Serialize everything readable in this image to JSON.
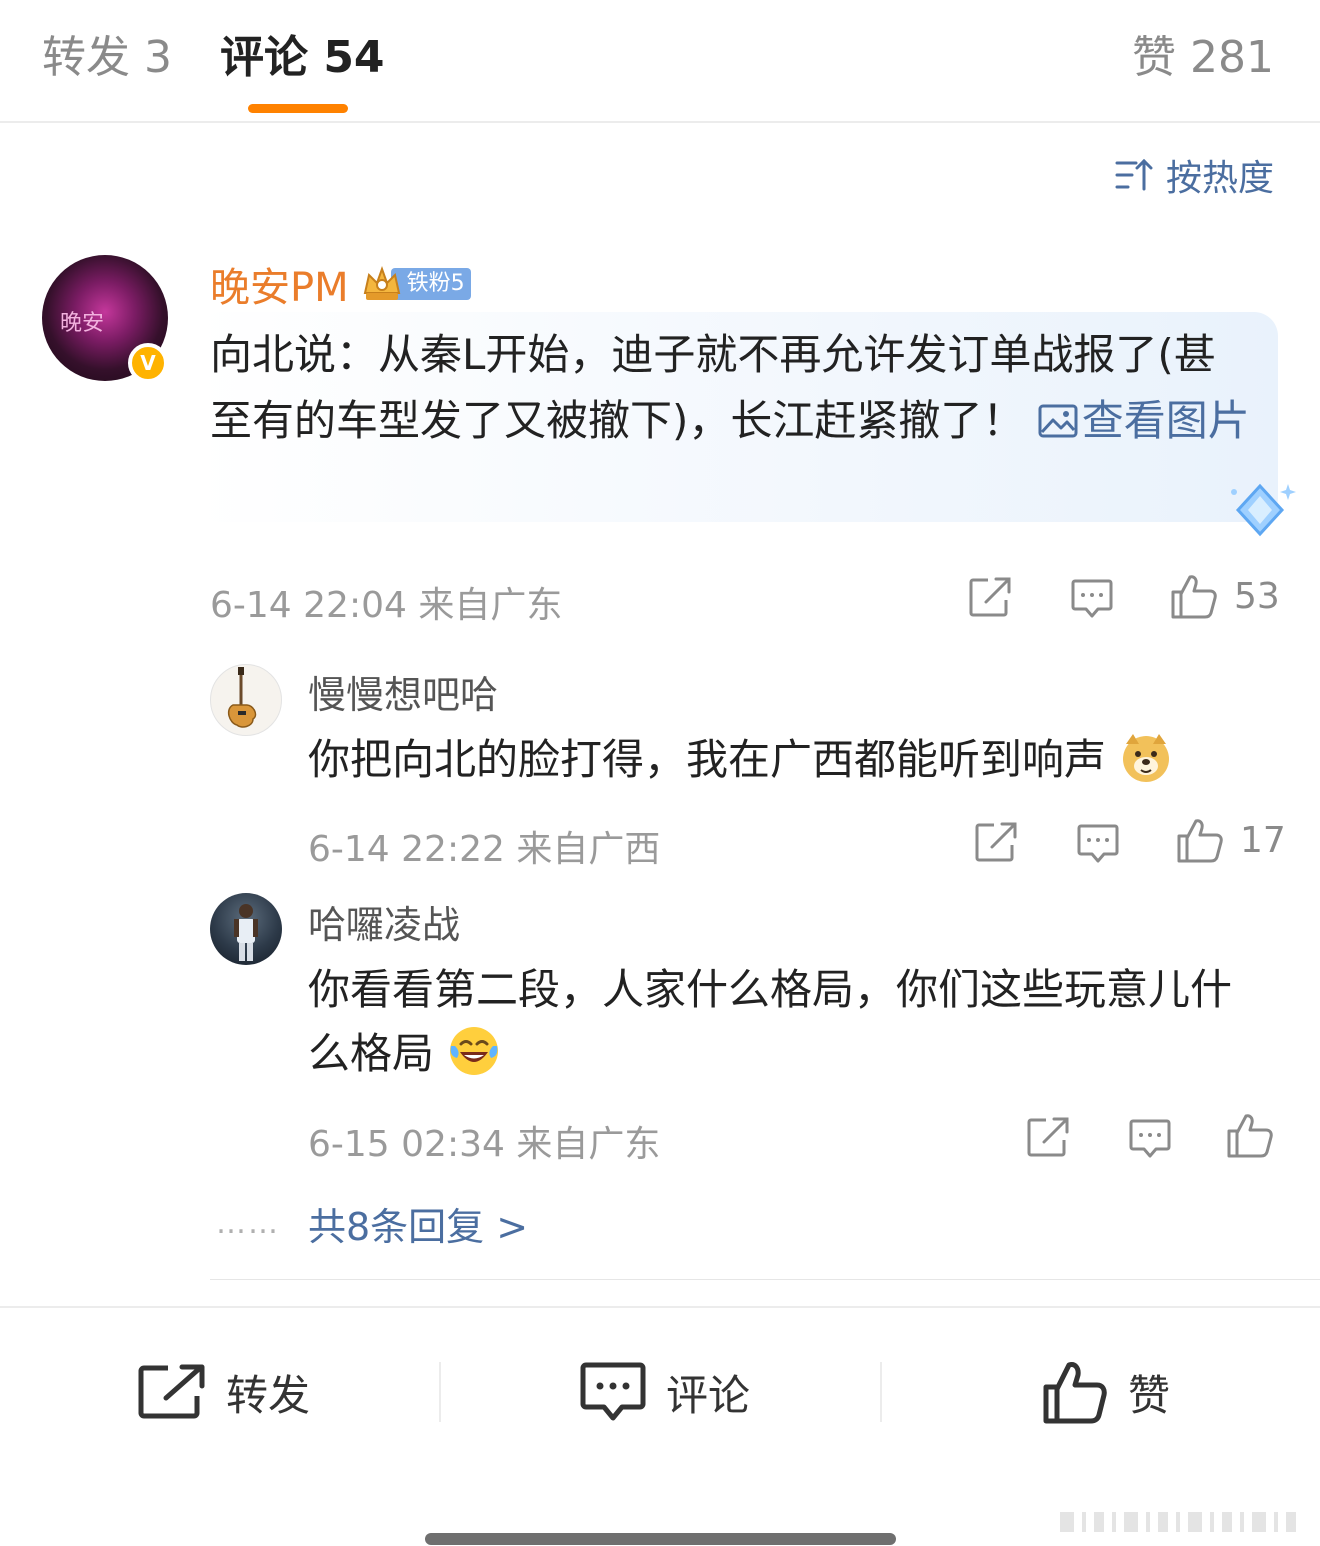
{
  "tabs": {
    "repost": "转发 3",
    "comment": "评论 54",
    "like": "赞 281"
  },
  "sort": {
    "label": "按热度"
  },
  "main_comment": {
    "username": "晚安PM",
    "avatar_text": "晚安",
    "fan_badge": "铁粉5",
    "text": "向北说：从秦L开始，迪子就不再允许发订单战报了(甚至有的车型发了又被撤下)，长江赶紧撤了！",
    "view_image": "查看图片",
    "meta": "6-14 22:04 来自广东",
    "likes": "53"
  },
  "replies": [
    {
      "username": "慢慢想吧哈",
      "text": "你把向北的脸打得，我在广西都能听到响声",
      "emoji": "doge-emoji",
      "meta": "6-14 22:22 来自广西",
      "likes": "17"
    },
    {
      "username": "哈囉凌战",
      "text": "你看看第二段，人家什么格局，你们这些玩意儿什么格局",
      "emoji": "laughing-crying-emoji",
      "meta": "6-15 02:34 来自广东",
      "likes": ""
    }
  ],
  "more_replies": {
    "dots": "……",
    "label": "共8条回复 >"
  },
  "bottom_bar": {
    "repost": "转发",
    "comment": "评论",
    "like": "赞"
  },
  "colors": {
    "accent": "#ff8200",
    "link": "#4b6ea0",
    "username_main": "#ea7d2b",
    "meta_gray": "#9a9a9a"
  },
  "icons": [
    "sort-icon",
    "image-icon",
    "repost-icon",
    "comment-icon",
    "like-icon",
    "verified-icon",
    "crown-icon",
    "diamond-icon"
  ]
}
